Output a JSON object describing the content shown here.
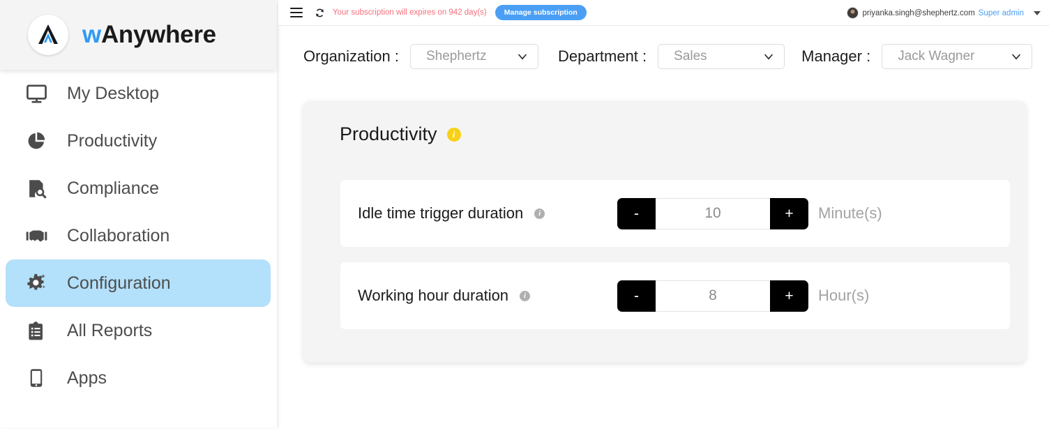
{
  "brand": {
    "prefix": "w",
    "name": "Anywhere",
    "logo_icon": "wanywhere-mountain-logo"
  },
  "sidebar": {
    "items": [
      {
        "label": "My Desktop",
        "icon": "monitor-icon",
        "active": false
      },
      {
        "label": "Productivity",
        "icon": "pie-chart-icon",
        "active": false
      },
      {
        "label": "Compliance",
        "icon": "document-search-icon",
        "active": false
      },
      {
        "label": "Collaboration",
        "icon": "handshake-icon",
        "active": false
      },
      {
        "label": "Configuration",
        "icon": "gear-sparkle-icon",
        "active": true
      },
      {
        "label": "All Reports",
        "icon": "clipboard-list-icon",
        "active": false
      },
      {
        "label": "Apps",
        "icon": "mobile-phone-icon",
        "active": false
      }
    ],
    "active_highlight_color": "#b3e0fa"
  },
  "topbar": {
    "menu_icon": "hamburger-icon",
    "sync_icon": "refresh-sync-icon",
    "subscription_message": "Your subscription will expires on 942 day(s)",
    "subscription_message_color": "#f4707b",
    "manage_button_label": "Manage subscription",
    "manage_button_color": "#4a9ff5",
    "user_email": "priyanka.singh@shephertz.com",
    "user_role": "Super admin",
    "user_role_color": "#4a9ff5",
    "avatar_icon": "user-avatar",
    "caret_icon": "chevron-down-icon"
  },
  "filters": [
    {
      "label": "Organization :",
      "value": "Shephertz",
      "chevron_icon": "chevron-down-icon"
    },
    {
      "label": "Department :",
      "value": "Sales",
      "chevron_icon": "chevron-down-icon"
    },
    {
      "label": "Manager :",
      "value": "Jack Wagner",
      "chevron_icon": "chevron-down-icon"
    }
  ],
  "card": {
    "title": "Productivity",
    "info_icon": "info-icon",
    "info_icon_glyph": "i",
    "info_icon_color": "#f7d117",
    "settings": [
      {
        "label": "Idle time trigger duration",
        "info_icon": "info-icon",
        "info_icon_glyph": "i",
        "decrement_label": "-",
        "value": "10",
        "increment_label": "+",
        "unit": "Minute(s)"
      },
      {
        "label": "Working hour duration",
        "info_icon": "info-icon",
        "info_icon_glyph": "i",
        "decrement_label": "-",
        "value": "8",
        "increment_label": "+",
        "unit": "Hour(s)"
      }
    ]
  }
}
